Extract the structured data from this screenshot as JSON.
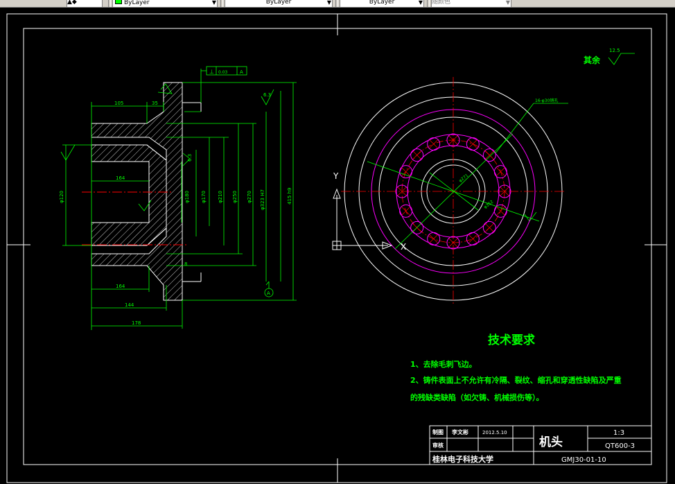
{
  "toolbar": {
    "layer_color": "ByLayer",
    "linetype": "ByLayer",
    "lineweight": "ByLayer",
    "plot_style": "随颜色"
  },
  "drawing": {
    "surface_finish_label": "其余",
    "surface_finish_value": "12.5",
    "finish_left": "6.3",
    "finish_mid": "6.3",
    "datum_label": "A",
    "tolerance_value": "0.03",
    "tolerance_datum": "A",
    "bolt_hole_note": "16-φ30销孔",
    "dim_105": "105",
    "dim_35": "35",
    "dim_164_top": "164",
    "dim_164_bot": "164",
    "dim_144": "144",
    "dim_178": "178",
    "dim_8": "8",
    "dim_d120": "φ120",
    "dim_d180": "φ180",
    "dim_d170": "φ170",
    "dim_d210": "φ210",
    "dim_d250": "φ250",
    "dim_d270": "φ270",
    "dim_d323": "φ323 H7",
    "dim_d415": "415 h9",
    "dim_d271": "φ271",
    "dim_d352": "φ352",
    "axis_y": "Y",
    "axis_x": "X",
    "tech_req_title": "技术要求",
    "tech_req_1": "1、去除毛刺飞边。",
    "tech_req_2a": "2、铸件表面上不允许有冷隔、裂纹、缩孔和穿透性缺陷及严重",
    "tech_req_2b": "的残缺类缺陷（如欠铸、机械损伤等）。"
  },
  "title_block": {
    "row1_label": "制图",
    "row1_name": "李文彬",
    "row1_date": "2012.5.10",
    "row2_label": "审核",
    "part_name": "机头",
    "scale": "1:3",
    "material": "QT600-3",
    "school": "桂林电子科技大学",
    "drawing_no": "GMJ30-01-10"
  },
  "colors": {
    "background": "#000000",
    "outline": "#ffffff",
    "dimension": "#00ff00",
    "centerline": "#ff0000",
    "holes": "#ff00ff",
    "text": "#00ff00"
  }
}
